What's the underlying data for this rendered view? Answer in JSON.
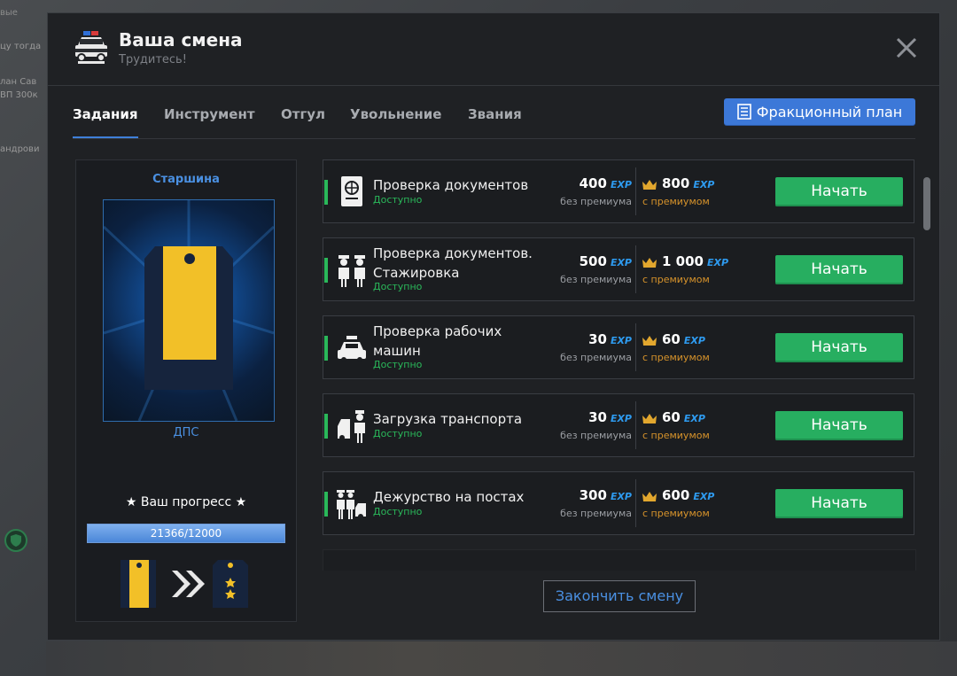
{
  "background": {
    "left_text": [
      "вые",
      "цу тогда",
      "лан  Сав",
      "ВП 300к",
      "андрови"
    ]
  },
  "header": {
    "title": "Ваша смена",
    "subtitle": "Трудитесь!",
    "icon": "police-car-icon",
    "close_icon": "close-icon"
  },
  "tabs": [
    {
      "label": "Задания",
      "active": true
    },
    {
      "label": "Инструмент",
      "active": false
    },
    {
      "label": "Отгул",
      "active": false
    },
    {
      "label": "Увольнение",
      "active": false
    },
    {
      "label": "Звания",
      "active": false
    }
  ],
  "faction_plan": {
    "label": "Фракционный план",
    "icon": "document-list-icon"
  },
  "rank": {
    "name": "Старшина",
    "division": "ДПС",
    "progress_label": "★ Ваш прогресс ★",
    "progress_text": "21366/12000",
    "progress_fraction": 1.0
  },
  "task_labels": {
    "status": "Доступно",
    "base": "без премиума",
    "premium": "с премиумом",
    "exp": "EXP",
    "start": "Начать"
  },
  "tasks": [
    {
      "name_lines": [
        "Проверка документов"
      ],
      "base": "400",
      "premium": "800",
      "icon": "passport-icon"
    },
    {
      "name_lines": [
        "Проверка документов.",
        "Стажировка"
      ],
      "base": "500",
      "premium": "1 000",
      "icon": "officers-icon"
    },
    {
      "name_lines": [
        "Проверка рабочих",
        "машин"
      ],
      "base": "30",
      "premium": "60",
      "icon": "police-car-icon"
    },
    {
      "name_lines": [
        "Загрузка транспорта"
      ],
      "base": "30",
      "premium": "60",
      "icon": "car-officer-icon"
    },
    {
      "name_lines": [
        "Дежурство на постах"
      ],
      "base": "300",
      "premium": "600",
      "icon": "guards-car-icon"
    }
  ],
  "finish_button": "Закончить смену",
  "colors": {
    "accent_blue": "#3c78d8",
    "start_green": "#27ae60",
    "status_green": "#2ab85a",
    "premium_orange": "#d7932b",
    "exp_blue": "#2e9bf0"
  }
}
